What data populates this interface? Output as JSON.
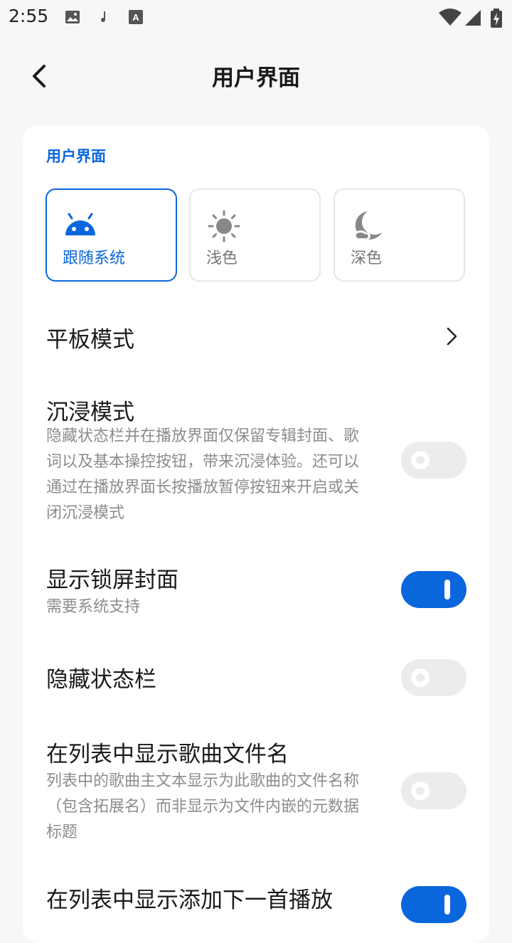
{
  "status_bar": {
    "time": "2:55",
    "left_icons": [
      "image-icon",
      "music-note-icon",
      "font-a-icon"
    ],
    "right_icons": [
      "wifi-icon",
      "signal-icon",
      "battery-charging-icon"
    ]
  },
  "header": {
    "title": "用户界面",
    "back_icon": "chevron-left-icon"
  },
  "section": {
    "title": "用户界面"
  },
  "theme_options": [
    {
      "label": "跟随系统",
      "icon": "android-icon",
      "selected": true
    },
    {
      "label": "浅色",
      "icon": "sun-icon",
      "selected": false
    },
    {
      "label": "深色",
      "icon": "moon-icon",
      "selected": false
    }
  ],
  "settings": {
    "tablet_mode": {
      "title": "平板模式"
    },
    "immersive_mode": {
      "title": "沉浸模式",
      "desc": "隐藏状态栏并在播放界面仅保留专辑封面、歌词以及基本操控按钮，带来沉浸体验。还可以通过在播放界面长按播放暂停按钮来开启或关闭沉浸模式",
      "enabled": false
    },
    "lockscreen_cover": {
      "title": "显示锁屏封面",
      "desc": "需要系统支持",
      "enabled": true
    },
    "hide_status_bar": {
      "title": "隐藏状态栏",
      "enabled": false
    },
    "show_filename": {
      "title": "在列表中显示歌曲文件名",
      "desc": "列表中的歌曲主文本显示为此歌曲的文件名称（包含拓展名）而非显示为文件内嵌的元数据标题",
      "enabled": false
    },
    "show_play_next": {
      "title": "在列表中显示添加下一首播放",
      "enabled": true
    }
  },
  "colors": {
    "accent": "#0a66dd",
    "background": "#f7f7f9",
    "card": "#ffffff",
    "toggle_off": "#ececec",
    "secondary_text": "#8c8c8c"
  }
}
